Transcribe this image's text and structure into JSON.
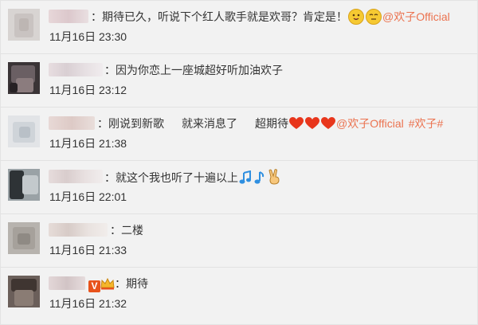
{
  "comments": [
    {
      "separator": "：",
      "text": "期待已久，听说下个红人歌手就是欢哥？肯定是！",
      "mention": "@欢子Official",
      "time": "11月16日 23:30",
      "icons": [
        "tongue-emoji",
        "thinking-emoji"
      ]
    },
    {
      "separator": "：",
      "text": "因为你恋上一座城超好听加油欢子",
      "time": "11月16日 23:12"
    },
    {
      "separator": "：",
      "text_a": "刚说到新歌",
      "text_b": "就来消息了",
      "text_c": "超期待",
      "mention": "@欢子Official",
      "hashtag": "#欢子#",
      "time": "11月16日 21:38",
      "icons": [
        "heart-icon",
        "heart-icon",
        "heart-icon"
      ]
    },
    {
      "separator": "：",
      "text": "就这个我也听了十遍以上",
      "time": "11月16日 22:01",
      "icons": [
        "music-note-icon",
        "music-note-icon",
        "victory-hand-icon"
      ]
    },
    {
      "separator": "：",
      "text": "二楼",
      "time": "11月16日 21:33"
    },
    {
      "verified_badge": "V",
      "separator": "：",
      "text": "期待",
      "time": "11月16日 21:32"
    }
  ],
  "colors": {
    "link": "#eb7350",
    "text": "#333333",
    "heart": "#e8361c",
    "note": "#2f8fe0",
    "emoji_yellow": "#f6c932"
  }
}
